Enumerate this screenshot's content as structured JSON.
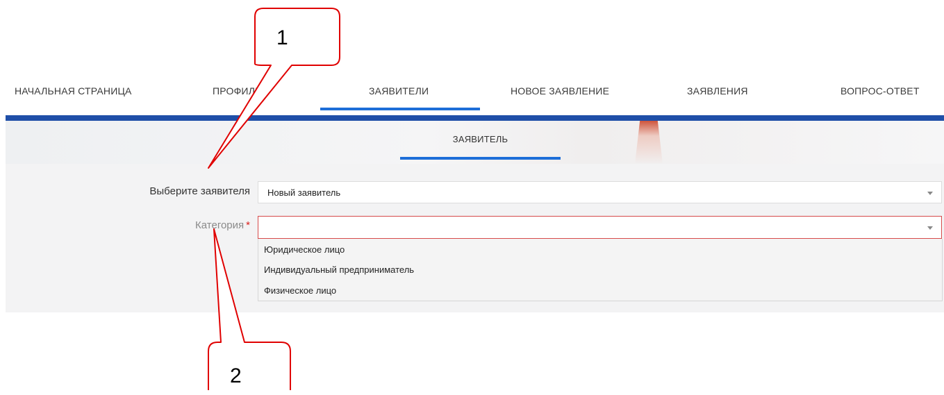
{
  "nav": {
    "items": [
      {
        "label": "НАЧАЛЬНАЯ СТРАНИЦА",
        "active": false
      },
      {
        "label": "ПРОФИЛЬ",
        "active": false
      },
      {
        "label": "ЗАЯВИТЕЛИ",
        "active": true
      },
      {
        "label": "НОВОЕ ЗАЯВЛЕНИЕ",
        "active": false
      },
      {
        "label": "ЗАЯВЛЕНИЯ",
        "active": false
      },
      {
        "label": "ВОПРОС-ОТВЕТ",
        "active": false
      }
    ]
  },
  "section": {
    "title": "ЗАЯВИТЕЛЬ"
  },
  "form": {
    "applicant_label": "Выберите заявителя",
    "applicant_value": "Новый заявитель",
    "category_label": "Категория",
    "category_required_mark": "*",
    "category_value": "",
    "category_options": [
      "Юридическое лицо",
      "Индивидуальный предприниматель",
      "Физическое лицо"
    ]
  },
  "callouts": {
    "first": "1",
    "second": "2"
  },
  "colors": {
    "accent": "#1d6ed8",
    "bar": "#1f4fa8",
    "required": "#d9201d",
    "callout": "#e00000"
  }
}
